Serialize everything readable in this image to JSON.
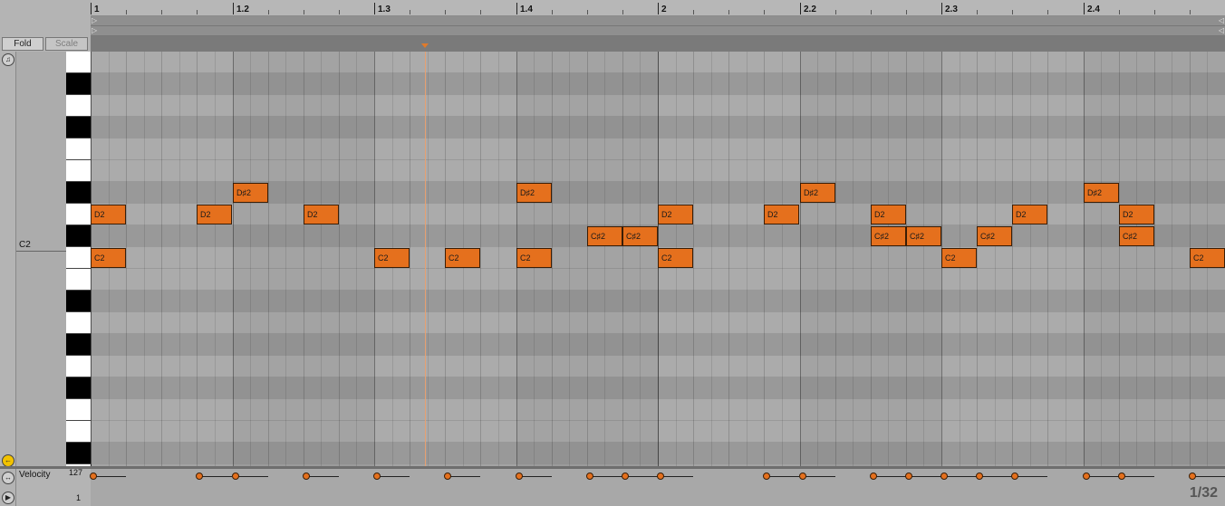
{
  "ruler": {
    "bars": [
      {
        "label": "1",
        "x": 0
      },
      {
        "label": "1.2",
        "x": 0.25
      },
      {
        "label": "1.3",
        "x": 0.5
      },
      {
        "label": "1.4",
        "x": 0.75
      },
      {
        "label": "2",
        "x": 1.0
      },
      {
        "label": "2.2",
        "x": 1.25
      },
      {
        "label": "2.3",
        "x": 1.5
      },
      {
        "label": "2.4",
        "x": 1.75
      }
    ]
  },
  "controls": {
    "fold_label": "Fold",
    "scale_label": "Scale"
  },
  "piano": {
    "c2_label": "C2"
  },
  "notes": [
    {
      "label": "D2",
      "start": 0.0,
      "duration": 0.0625
    },
    {
      "label": "C2",
      "start": 0.0,
      "duration": 0.0625
    },
    {
      "label": "D2",
      "start": 0.1875,
      "duration": 0.0625
    },
    {
      "label": "D♯2",
      "start": 0.25,
      "duration": 0.0625
    },
    {
      "label": "D2",
      "start": 0.375,
      "duration": 0.0625
    },
    {
      "label": "C2",
      "start": 0.5,
      "duration": 0.0625
    },
    {
      "label": "C2",
      "start": 0.625,
      "duration": 0.0625
    },
    {
      "label": "D♯2",
      "start": 0.75,
      "duration": 0.0625
    },
    {
      "label": "C2",
      "start": 0.75,
      "duration": 0.0625
    },
    {
      "label": "C♯2",
      "start": 0.875,
      "duration": 0.0625
    },
    {
      "label": "C♯2",
      "start": 0.9375,
      "duration": 0.0625
    },
    {
      "label": "D2",
      "start": 1.0,
      "duration": 0.0625
    },
    {
      "label": "C2",
      "start": 1.0,
      "duration": 0.0625
    },
    {
      "label": "D2",
      "start": 1.1875,
      "duration": 0.0625
    },
    {
      "label": "D♯2",
      "start": 1.25,
      "duration": 0.0625
    },
    {
      "label": "D2",
      "start": 1.375,
      "duration": 0.0625
    },
    {
      "label": "C♯2",
      "start": 1.375,
      "duration": 0.0625
    },
    {
      "label": "C♯2",
      "start": 1.4375,
      "duration": 0.0625
    },
    {
      "label": "C2",
      "start": 1.5,
      "duration": 0.0625
    },
    {
      "label": "C♯2",
      "start": 1.5625,
      "duration": 0.0625
    },
    {
      "label": "D2",
      "start": 1.625,
      "duration": 0.0625
    },
    {
      "label": "D♯2",
      "start": 1.75,
      "duration": 0.0625
    },
    {
      "label": "D2",
      "start": 1.8125,
      "duration": 0.0625
    },
    {
      "label": "C♯2",
      "start": 1.8125,
      "duration": 0.0625
    },
    {
      "label": "C2",
      "start": 1.9375,
      "duration": 0.0625
    }
  ],
  "velocity": {
    "label": "Velocity",
    "max_label": "127",
    "min_label": "1"
  },
  "grid": {
    "resolution_label": "1/32"
  },
  "colors": {
    "note_fill": "#e5701d",
    "playhead": "#e7a070"
  },
  "icons": [
    "headphones-icon",
    "fold-icon",
    "velocity-icon",
    "play-icon"
  ]
}
